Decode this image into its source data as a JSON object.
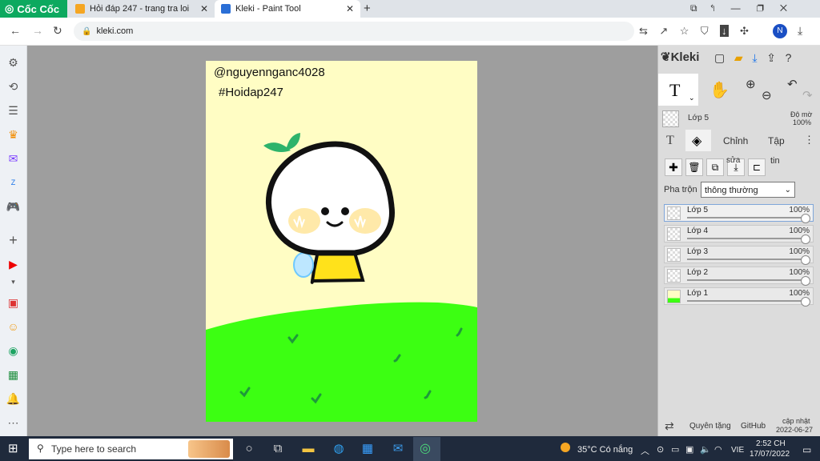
{
  "browser": {
    "brand": "Cốc Cốc",
    "tabs": [
      {
        "title": "Hỏi đáp 247 - trang tra loi"
      },
      {
        "title": "Kleki - Paint Tool"
      }
    ],
    "new_tab": "+",
    "url": "kleki.com",
    "profile_initial": "N"
  },
  "canvas": {
    "watermark_user": "@nguyennganc4028",
    "watermark_tag": "#Hoidap247",
    "colors": {
      "paper": "#fffdc4",
      "grass": "#3cff12",
      "leaf": "#2db36b"
    }
  },
  "kleki": {
    "logo": "Kleki",
    "active_layer": "Lớp 5",
    "opacity_label": "Độ mờ",
    "opacity_value": "100%",
    "tabs": {
      "text_tab": "T",
      "edit": "Chỉnh",
      "file": "Tập"
    },
    "actions_label_1": "sửa",
    "actions_label_2": "tin",
    "blend_label": "Pha trộn",
    "blend_value": "thông thường",
    "layers": [
      {
        "name": "Lớp 5",
        "opacity": "100%"
      },
      {
        "name": "Lớp 4",
        "opacity": "100%"
      },
      {
        "name": "Lớp 3",
        "opacity": "100%"
      },
      {
        "name": "Lớp 2",
        "opacity": "100%"
      },
      {
        "name": "Lớp 1",
        "opacity": "100%"
      }
    ],
    "footer": {
      "donate": "Quyên tặng",
      "github": "GitHub",
      "update_line1": "cập nhật",
      "update_line2": "2022-06-27"
    }
  },
  "taskbar": {
    "search_placeholder": "Type here to search",
    "weather": "35°C  Có nắng",
    "lang": "VIE",
    "time": "2:52 CH",
    "date": "17/07/2022"
  }
}
